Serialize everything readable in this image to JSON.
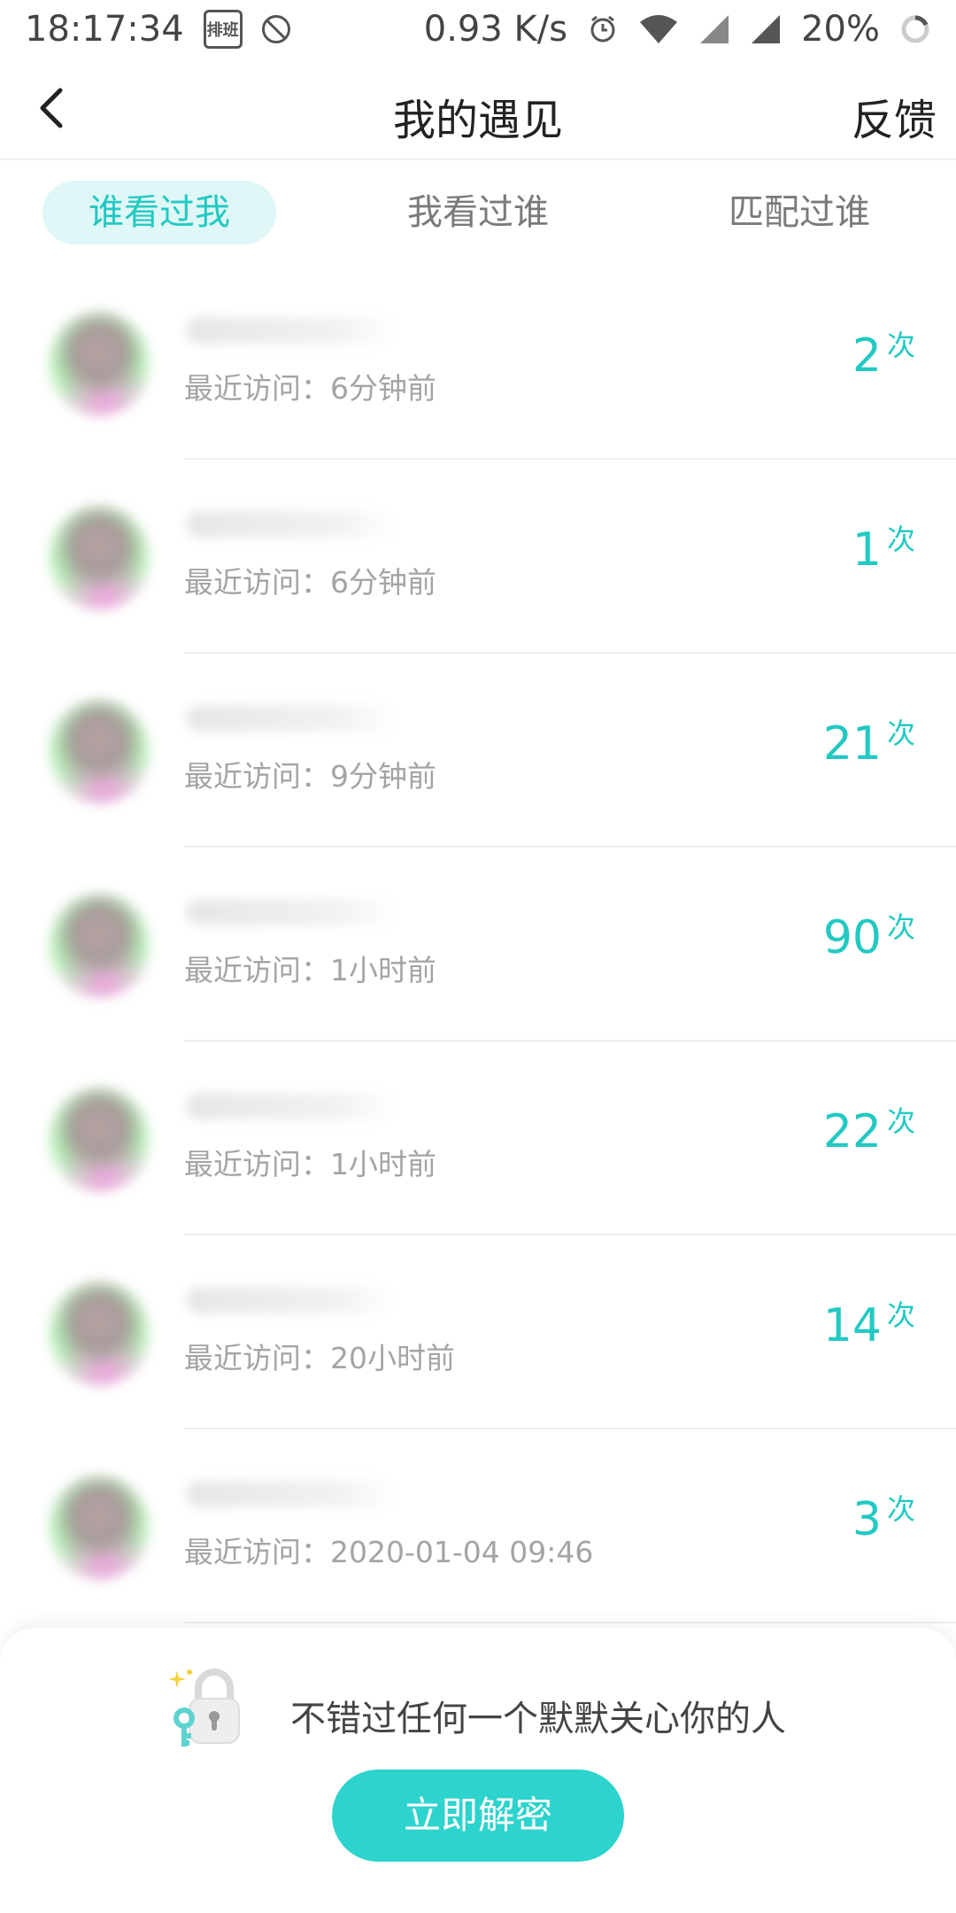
{
  "status_bar": {
    "time": "18:17:34",
    "calendar_text": "排班",
    "net_speed": "0.93 K/s",
    "battery": "20%"
  },
  "nav": {
    "title": "我的遇见",
    "feedback": "反馈"
  },
  "tabs": [
    {
      "label": "谁看过我",
      "active": true
    },
    {
      "label": "我看过谁",
      "active": false
    },
    {
      "label": "匹配过谁",
      "active": false
    }
  ],
  "visitors": [
    {
      "last_visit": "最近访问：6分钟前",
      "count": "2",
      "unit": "次"
    },
    {
      "last_visit": "最近访问：6分钟前",
      "count": "1",
      "unit": "次"
    },
    {
      "last_visit": "最近访问：9分钟前",
      "count": "21",
      "unit": "次"
    },
    {
      "last_visit": "最近访问：1小时前",
      "count": "90",
      "unit": "次"
    },
    {
      "last_visit": "最近访问：1小时前",
      "count": "22",
      "unit": "次"
    },
    {
      "last_visit": "最近访问：20小时前",
      "count": "14",
      "unit": "次"
    },
    {
      "last_visit": "最近访问：2020-01-04 09:46",
      "count": "3",
      "unit": "次"
    }
  ],
  "unlock": {
    "text": "不错过任何一个默默关心你的人",
    "button": "立即解密"
  },
  "colors": {
    "accent": "#22c9c3",
    "button": "#2dd3cd",
    "active_tab_bg": "#dff7f6"
  }
}
